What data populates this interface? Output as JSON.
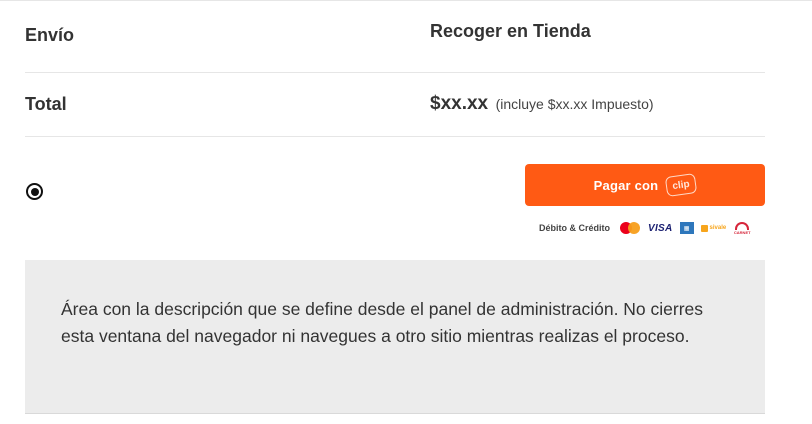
{
  "shipping": {
    "label": "Envío",
    "value": "Recoger en Tienda"
  },
  "total": {
    "label": "Total",
    "price": "$xx.xx",
    "tax_note": "(incluye $xx.xx Impuesto)"
  },
  "payment": {
    "selected": true,
    "button_label": "Pagar con",
    "brand_badge": "clip",
    "methods_label": "Débito & Crédito",
    "card_icons": [
      "mastercard-icon",
      "visa-icon",
      "amex-icon",
      "sivale-icon",
      "carnet-icon"
    ],
    "visa_text": "VISA",
    "sivale_text": "sivale",
    "carnet_text": "CARNET",
    "accent_color": "#ff5a14"
  },
  "description": {
    "text": "Área con la descripción que se define desde el panel de administración. No cierres esta ventana del navegador ni navegues a otro sitio mientras realizas el proceso."
  }
}
